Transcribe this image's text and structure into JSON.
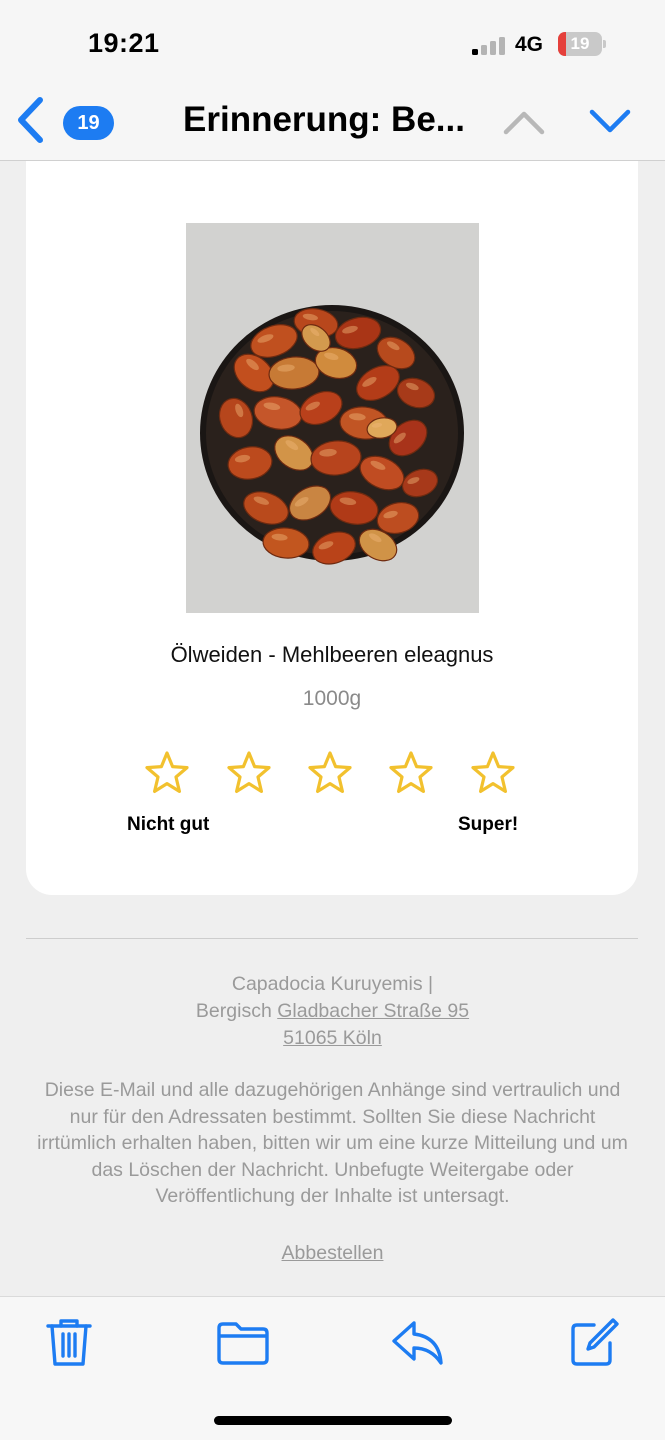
{
  "status_bar": {
    "time": "19:21",
    "network": "4G",
    "battery_level": "19",
    "signal_bars_active": 1,
    "battery_fraction": 0.19,
    "battery_color": "#e5403b"
  },
  "nav": {
    "back_icon": "chevron-left-icon",
    "unread_count": "19",
    "title": "Erinnerung: Be...",
    "prev_icon": "chevron-up-icon",
    "next_icon": "chevron-down-icon",
    "accent_color": "#1d7cf2"
  },
  "product": {
    "image": "bowl of dried jujube fruits",
    "name": "Ölweiden - Mehlbeeren eleagnus",
    "quantity": "1000g"
  },
  "rating": {
    "star_count": 5,
    "selected": 0,
    "star_color": "#f2c12e",
    "low_label": "Nicht gut",
    "high_label": "Super!"
  },
  "footer": {
    "company": "Capadocia Kuruyemis |",
    "street_prefix": "Bergisch",
    "street_link": "Gladbacher Straße 95",
    "city_link": "51065 Köln",
    "disclaimer": "Diese E-Mail und alle dazugehörigen Anhänge sind vertraulich und nur für den Adressaten bestimmt. Sollten Sie diese Nachricht irrtümlich erhalten haben, bitten wir um eine kurze Mitteilung und um das Löschen der Nachricht. Unbefugte Weitergabe oder Veröffentlichung der Inhalte ist untersagt.",
    "unsubscribe": "Abbestellen"
  },
  "toolbar": {
    "items": [
      {
        "icon": "trash-icon",
        "action": "delete"
      },
      {
        "icon": "folder-icon",
        "action": "move"
      },
      {
        "icon": "reply-icon",
        "action": "reply"
      },
      {
        "icon": "compose-icon",
        "action": "compose"
      }
    ]
  }
}
